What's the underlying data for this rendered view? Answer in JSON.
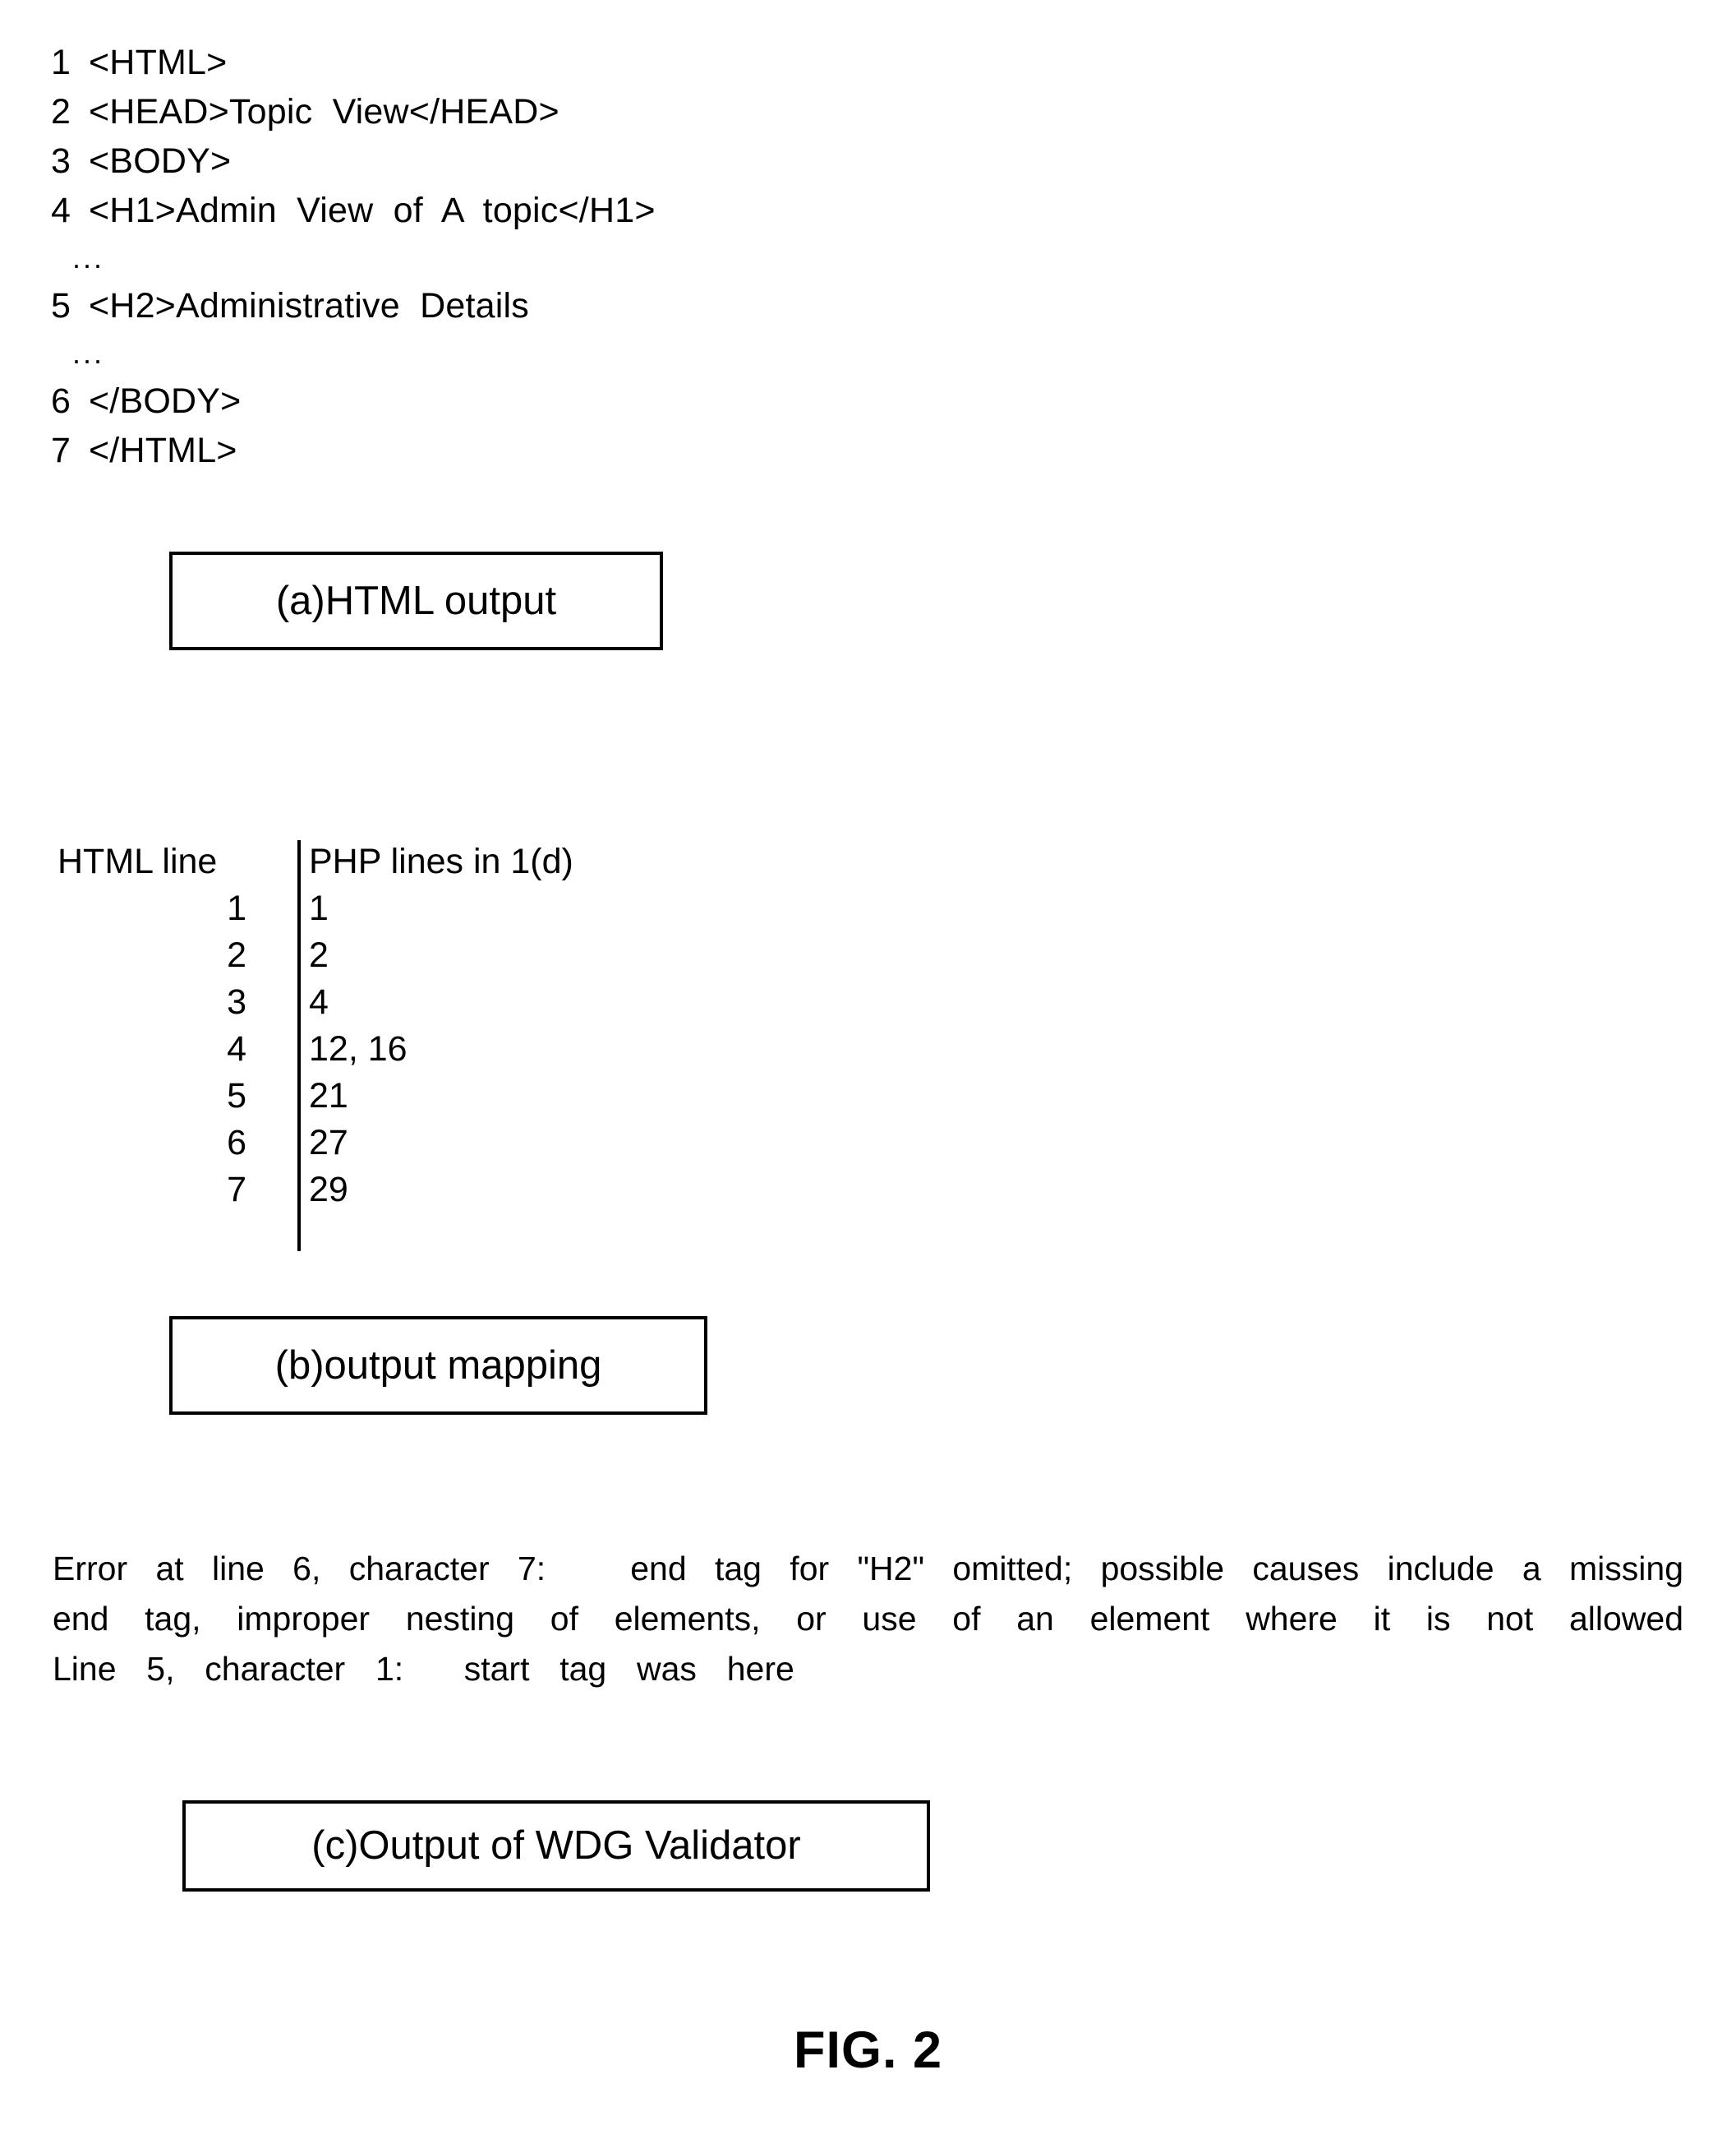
{
  "code_listing": {
    "lines": [
      {
        "number": "1",
        "source": "<HTML>"
      },
      {
        "number": "2",
        "source": "<HEAD>Topic  View</HEAD>"
      },
      {
        "number": "3",
        "source": "<BODY>"
      },
      {
        "number": "4",
        "source": "<H1>Admin  View  of  A  topic</H1>"
      },
      {
        "number": "",
        "source": "..."
      },
      {
        "number": "5",
        "source": "<H2>Administrative  Details"
      },
      {
        "number": "",
        "source": "..."
      },
      {
        "number": "6",
        "source": "</BODY>"
      },
      {
        "number": "7",
        "source": "</HTML>"
      }
    ],
    "ellipsis": "..."
  },
  "captions": {
    "a": "(a)HTML output",
    "b": "(b)output mapping",
    "c": "(c)Output of WDG Validator"
  },
  "mapping_table": {
    "headers": {
      "left": "HTML line",
      "right": "PHP lines in 1(d)"
    },
    "rows": [
      {
        "html_line": "1",
        "php_lines": "1"
      },
      {
        "html_line": "2",
        "php_lines": "2"
      },
      {
        "html_line": "3",
        "php_lines": "4"
      },
      {
        "html_line": "4",
        "php_lines": "12, 16"
      },
      {
        "html_line": "5",
        "php_lines": "21"
      },
      {
        "html_line": "6",
        "php_lines": "27"
      },
      {
        "html_line": "7",
        "php_lines": "29"
      }
    ]
  },
  "validator_output": {
    "line1": "Error at line 6, character 7:   end tag for \"H2\" omitted; possible causes include a missing",
    "line2": "end tag, improper nesting of elements, or use of an element where it is not allowed",
    "line3": "Line  5,  character  1:    start  tag  was  here"
  },
  "figure": {
    "label": "FIG. 2"
  }
}
